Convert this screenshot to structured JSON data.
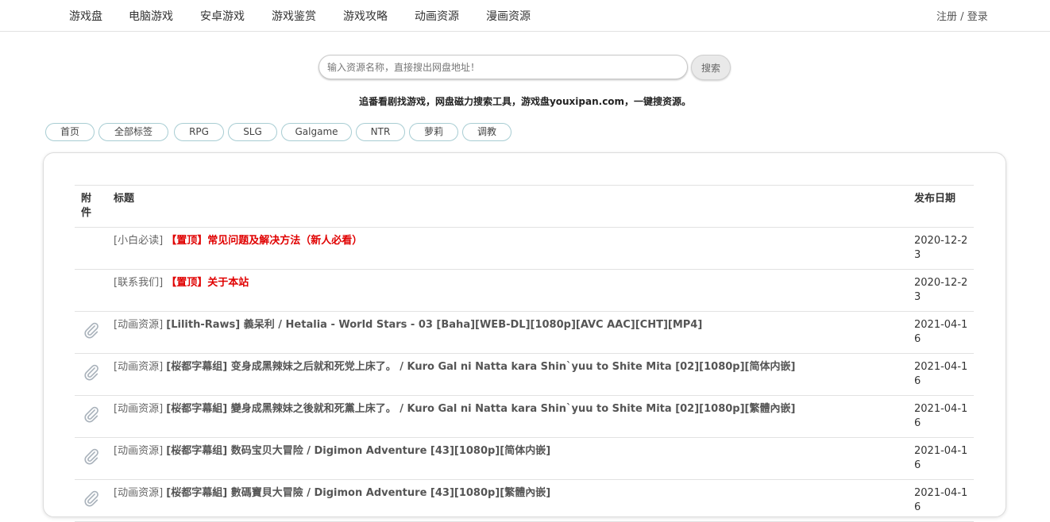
{
  "nav": {
    "items": [
      "游戏盘",
      "电脑游戏",
      "安卓游戏",
      "游戏鉴赏",
      "游戏攻略",
      "动画资源",
      "漫画资源"
    ],
    "register": "注册",
    "separator": "/",
    "login": "登录"
  },
  "search": {
    "placeholder": "输入资源名称，直接搜出网盘地址！",
    "value": "",
    "button": "搜索"
  },
  "slogan": "追番看剧找游戏，网盘磁力搜索工具，游戏盘youxipan.com，一键搜资源。",
  "tags": [
    "首页",
    "全部标签",
    "RPG",
    "SLG",
    "Galgame",
    "NTR",
    "萝莉",
    "调教"
  ],
  "table": {
    "headers": {
      "attach": "附件",
      "title": "标题",
      "date": "发布日期"
    },
    "rows": [
      {
        "category": "[小白必读]",
        "title": "【置顶】常见问题及解决方法（新人必看）",
        "date": "2020-12-23",
        "pinned": true,
        "attachment": false
      },
      {
        "category": "[联系我们]",
        "title": "【置顶】关于本站",
        "date": "2020-12-23",
        "pinned": true,
        "attachment": false
      },
      {
        "category": "[动画资源]",
        "title": "[Lilith-Raws] 義呆利 / Hetalia - World Stars - 03 [Baha][WEB-DL][1080p][AVC AAC][CHT][MP4]",
        "date": "2021-04-16",
        "pinned": false,
        "attachment": true
      },
      {
        "category": "[动画资源]",
        "title": "[桜都字幕组] 变身成黑辣妹之后就和死党上床了。 / Kuro Gal ni Natta kara Shin`yuu to Shite Mita [02][1080p][简体内嵌]",
        "date": "2021-04-16",
        "pinned": false,
        "attachment": true
      },
      {
        "category": "[动画资源]",
        "title": "[桜都字幕組] 變身成黑辣妹之後就和死黨上床了。 / Kuro Gal ni Natta kara Shin`yuu to Shite Mita [02][1080p][繁體內嵌]",
        "date": "2021-04-16",
        "pinned": false,
        "attachment": true
      },
      {
        "category": "[动画资源]",
        "title": "[桜都字幕组] 数码宝贝大冒险 / Digimon Adventure [43][1080p][简体内嵌]",
        "date": "2021-04-16",
        "pinned": false,
        "attachment": true
      },
      {
        "category": "[动画资源]",
        "title": "[桜都字幕組] 數碼寶貝大冒險 / Digimon Adventure [43][1080p][繁體內嵌]",
        "date": "2021-04-16",
        "pinned": false,
        "attachment": true
      }
    ]
  },
  "icons": {
    "attachment": "paperclip-icon"
  },
  "colors": {
    "pinned": "#e00000",
    "tag_border": "#a8cdd3",
    "divider": "#e2e2e2"
  }
}
